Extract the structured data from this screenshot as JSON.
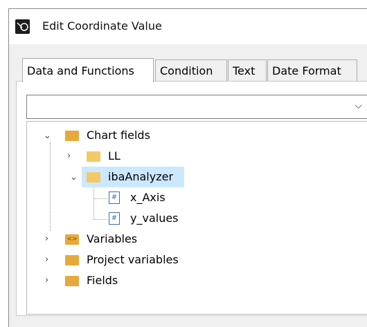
{
  "window": {
    "title": "Edit Coordinate Value"
  },
  "tabs": [
    {
      "label": "Data and Functions"
    },
    {
      "label": "Condition"
    },
    {
      "label": "Text"
    },
    {
      "label": "Date Format"
    }
  ],
  "combo": {
    "value": ""
  },
  "tree": {
    "chart_fields": "Chart fields",
    "ll": "LL",
    "ibaanalyzer": "ibaAnalyzer",
    "x_axis": "x_Axis",
    "y_values": "y_values",
    "variables": "Variables",
    "project_variables": "Project variables",
    "fields": "Fields"
  },
  "icons": {
    "app": "app-icon",
    "expand": "chevron-down-icon",
    "collapse": "chevron-right-icon",
    "folder": "folder-icon",
    "field": "field-icon",
    "variables": "variables-icon",
    "project_variables": "project-variables-icon",
    "fields": "fields-icon"
  }
}
